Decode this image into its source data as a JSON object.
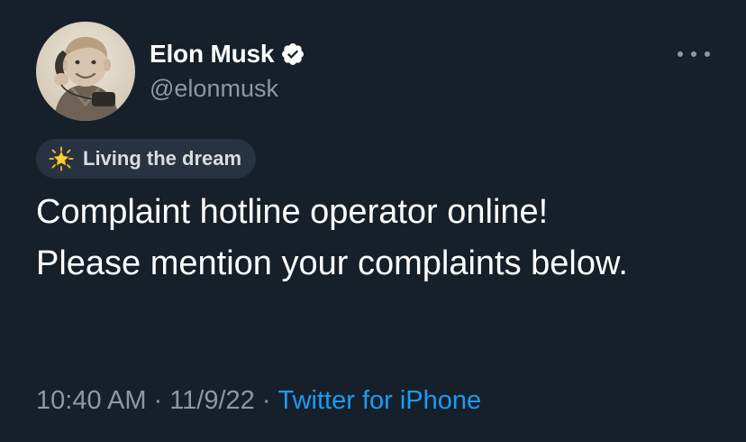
{
  "user": {
    "display_name": "Elon Musk",
    "handle": "@elonmusk",
    "verified": true,
    "avatar": "vintage-child-photo-avatar"
  },
  "badge": {
    "icon": "glowing-star-icon",
    "label": "Living the dream"
  },
  "tweet": {
    "text": "Complaint hotline operator online!\nPlease mention your complaints below.",
    "time": "10:40 AM",
    "date": "11/9/22",
    "source": "Twitter for iPhone",
    "separator": "·"
  },
  "colors": {
    "background": "#15202b",
    "primary_text": "#ffffff",
    "secondary_text": "#8b98a5",
    "link": "#1d9bf0",
    "badge_background": "#273340"
  },
  "icons": {
    "verified": "verified-badge-icon",
    "more": "more-options-icon"
  }
}
